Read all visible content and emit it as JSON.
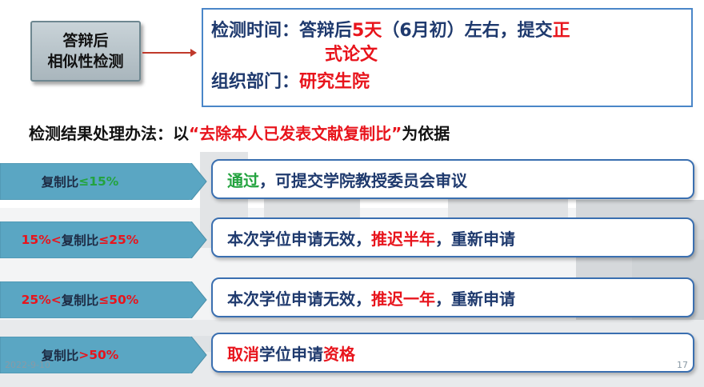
{
  "title_button": {
    "line1": "答辩后",
    "line2": "相似性检测"
  },
  "info_box": {
    "time_label": "检测时间：",
    "time_pre": "答辩后",
    "time_days": "5天",
    "time_mid": "（6月初）左右，提交",
    "time_formal": "正",
    "time_formal_cont": "式论文",
    "org_label": "组织部门：",
    "org_value": "研究生院"
  },
  "method": {
    "prefix": "检测结果处理办法：以",
    "quote": "“去除本人已发表文献复制比”",
    "suffix": "为依据"
  },
  "rules": [
    {
      "label_pre": "复制比",
      "label_cond": "≤15%",
      "result_highlight": "通过",
      "result_rest": "，可提交学院教授委员会审议"
    },
    {
      "label_pre": "复制比",
      "label_a": "15%<",
      "label_cond": "≤25%",
      "result_pre": "本次学位申请无效，",
      "result_highlight": "推迟半年",
      "result_rest": "，重新申请"
    },
    {
      "label_pre": "复制比",
      "label_a": "25%<",
      "label_cond": "≤50%",
      "result_pre": "本次学位申请无效，",
      "result_highlight": "推迟一年",
      "result_rest": "，重新申请"
    },
    {
      "label_pre": "复制比",
      "label_cond": ">50%",
      "result_highlight": "取消",
      "result_mid": "学位申请",
      "result_highlight2": "资格"
    }
  ],
  "footer": {
    "date": "2022-9-10",
    "page": "17"
  },
  "colors": {
    "accent_red": "#e8141c",
    "accent_green": "#23a33f",
    "arrow_fill": "#5aa6c3",
    "box_border": "#3a6fb0"
  }
}
